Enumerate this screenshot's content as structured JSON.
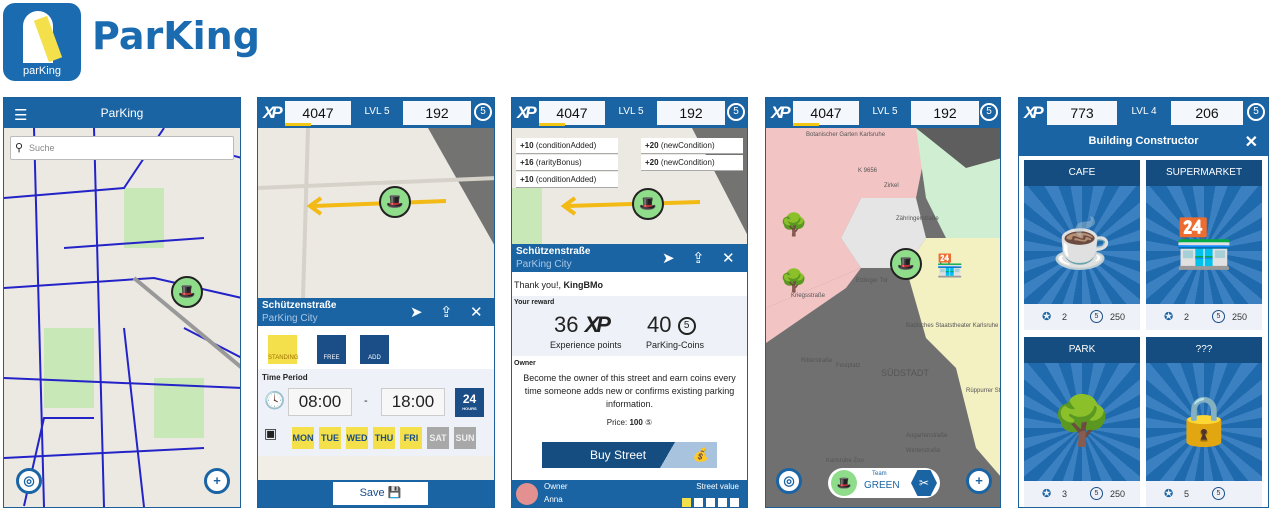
{
  "logo": {
    "icon_text": "parKing",
    "wordmark": "ParKing"
  },
  "screen1": {
    "title": "ParKing",
    "search_placeholder": "Suche",
    "icons": [
      "menu-icon",
      "search-icon",
      "locate-icon",
      "add-icon"
    ]
  },
  "hud": {
    "xp_label": "XP",
    "xp": "4047",
    "level": "LVL 5",
    "coins": "192",
    "coin_glyph": "5"
  },
  "screen2": {
    "street": "Schützenstraße",
    "city": "ParKing City",
    "conditions": [
      {
        "label": "STANDING",
        "color": "#f3e04a"
      },
      {
        "label": "FREE",
        "color": "#1b4d87"
      },
      {
        "label": "ADD",
        "color": "#1b4d87"
      }
    ],
    "time_period_label": "Time Period",
    "from": "08:00",
    "dash": "-",
    "to": "18:00",
    "hours_badge": "24",
    "hours_sub": "HOURS",
    "days": [
      {
        "label": "MON",
        "active": true
      },
      {
        "label": "TUE",
        "active": true
      },
      {
        "label": "WED",
        "active": true
      },
      {
        "label": "THU",
        "active": true
      },
      {
        "label": "FRI",
        "active": true
      },
      {
        "label": "SAT",
        "active": false
      },
      {
        "label": "SUN",
        "active": false
      }
    ],
    "save_label": "Save"
  },
  "screen3": {
    "xp_popups": [
      {
        "pts": "+10",
        "reason": "(conditionAdded)"
      },
      {
        "pts": "+16",
        "reason": "(rarityBonus)"
      },
      {
        "pts": "+10",
        "reason": "(conditionAdded)"
      }
    ],
    "coin_popups": [
      {
        "pts": "+20",
        "reason": "(newCondition)"
      },
      {
        "pts": "+20",
        "reason": "(newCondition)"
      }
    ],
    "street": "Schützenstraße",
    "city": "ParKing City",
    "thanks": "Thank you!, ",
    "user": "KingBMo",
    "reward_label": "Your reward",
    "xp_reward": "36",
    "xp_unit": "XP",
    "xp_caption": "Experience points",
    "coin_reward": "40",
    "coin_caption": "ParKing-Coins",
    "owner_label": "Owner",
    "owner_text": "Become the owner of this street and earn coins every time someone adds new or confirms existing parking information.",
    "price_label": "Price:",
    "price": "100",
    "buy_label": "Buy Street",
    "footer_owner_label": "Owner",
    "footer_owner": "Anna",
    "street_value_label": "Street value",
    "street_value": 1,
    "street_value_max": 5
  },
  "screen4": {
    "map_labels": [
      "Botanischer Garten Karlsruhe",
      "K 9656",
      "Zirkel",
      "Zähringerstraße",
      "Ettlinger Tor",
      "Kriegsstraße",
      "Badisches Staatstheater Karlsruhe",
      "Ritterstraße",
      "Festplatz",
      "SÜDSTADT",
      "Augartenstraße",
      "Winterstraße",
      "Karlsruhe Zoo",
      "Rüppurrer Straße"
    ],
    "team_label": "Team",
    "team": "GREEN",
    "team_color": "#8fdc8a"
  },
  "screen5": {
    "xp": "773",
    "level": "LVL 4",
    "coins": "206",
    "title": "Building Constructor",
    "buildings": [
      {
        "name": "CAFE",
        "level": "2",
        "price": "250"
      },
      {
        "name": "SUPERMARKET",
        "level": "2",
        "price": "250"
      },
      {
        "name": "PARK",
        "level": "3",
        "price": "250"
      },
      {
        "name": "???",
        "level": "5",
        "price": "",
        "locked": true
      }
    ]
  }
}
